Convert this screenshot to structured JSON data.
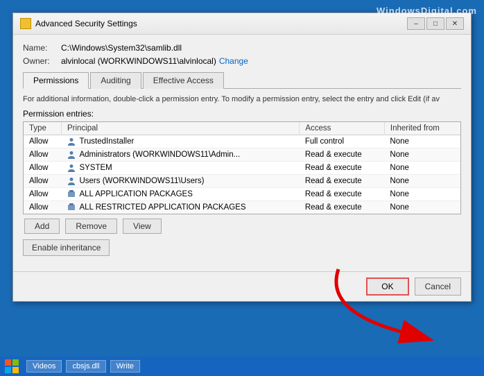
{
  "watermark": {
    "prefix": "Windows",
    "suffix": "Digital.com"
  },
  "title_bar": {
    "icon_label": "folder-icon",
    "title": "Advanced Security Settings",
    "minimize_label": "–",
    "maximize_label": "□",
    "close_label": "✕"
  },
  "file_info": {
    "name_label": "Name:",
    "name_value": "C:\\Windows\\System32\\samlib.dll",
    "owner_label": "Owner:",
    "owner_value": "alvinlocal (WORKWINDOWS11\\alvinlocal)",
    "change_link": "Change"
  },
  "tabs": [
    {
      "id": "permissions",
      "label": "Permissions",
      "active": true
    },
    {
      "id": "auditing",
      "label": "Auditing",
      "active": false
    },
    {
      "id": "effective",
      "label": "Effective Access",
      "active": false
    }
  ],
  "info_text": "For additional information, double-click a permission entry. To modify a permission entry, select the entry and click Edit (if av",
  "section_label": "Permission entries:",
  "table_headers": [
    "Type",
    "Principal",
    "Access",
    "Inherited from"
  ],
  "permission_entries": [
    {
      "type": "Allow",
      "principal": "TrustedInstaller",
      "access": "Full control",
      "inherited_from": "None",
      "icon": "user"
    },
    {
      "type": "Allow",
      "principal": "Administrators (WORKWINDOWS11\\Admin...",
      "access": "Read & execute",
      "inherited_from": "None",
      "icon": "user"
    },
    {
      "type": "Allow",
      "principal": "SYSTEM",
      "access": "Read & execute",
      "inherited_from": "None",
      "icon": "user"
    },
    {
      "type": "Allow",
      "principal": "Users (WORKWINDOWS11\\Users)",
      "access": "Read & execute",
      "inherited_from": "None",
      "icon": "user"
    },
    {
      "type": "Allow",
      "principal": "ALL APPLICATION PACKAGES",
      "access": "Read & execute",
      "inherited_from": "None",
      "icon": "pkg"
    },
    {
      "type": "Allow",
      "principal": "ALL RESTRICTED APPLICATION PACKAGES",
      "access": "Read & execute",
      "inherited_from": "None",
      "icon": "pkg"
    }
  ],
  "buttons": {
    "add": "Add",
    "remove": "Remove",
    "view": "View",
    "enable_inheritance": "Enable inheritance",
    "ok": "OK",
    "cancel": "Cancel"
  },
  "taskbar_items": [
    {
      "label": "Videos",
      "active": false
    },
    {
      "label": "cbsjs.dll",
      "active": false
    },
    {
      "label": "Write",
      "active": false
    }
  ]
}
